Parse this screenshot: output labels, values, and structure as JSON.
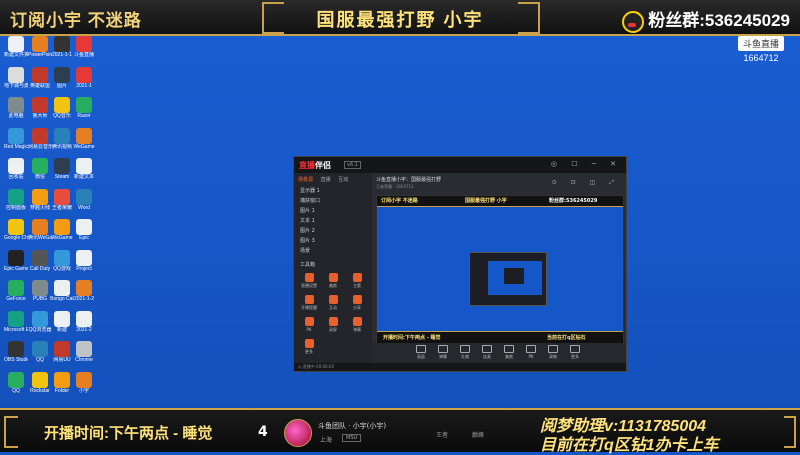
{
  "top_bar": {
    "left_text": "订阅小宇 不迷路",
    "center_text": "国服最强打野 小宇",
    "right_text": "粉丝群:536245029"
  },
  "watermark": {
    "logo": "斗鱼直播",
    "room_id": "1664712"
  },
  "desktop_icons": [
    {
      "label": "新建文件夹",
      "color": "#eef2f8"
    },
    {
      "label": "PowerPoint",
      "color": "#e67e22"
    },
    {
      "label": "2021-1-1",
      "color": "#333"
    },
    {
      "label": "斗鱼直播",
      "color": "#e53935"
    },
    {
      "label": "地下城与勇士",
      "color": "#ddd"
    },
    {
      "label": "英雄联盟",
      "color": "#c0392b"
    },
    {
      "label": "图片",
      "color": "#2c3e50"
    },
    {
      "label": "2021-1",
      "color": "#e53935"
    },
    {
      "label": "此电脑",
      "color": "#7f8c8d"
    },
    {
      "label": "鲁大师",
      "color": "#c0392b"
    },
    {
      "label": "QQ音乐",
      "color": "#f1c40f"
    },
    {
      "label": "Razer",
      "color": "#27ae60"
    },
    {
      "label": "Red Magic",
      "color": "#3498db"
    },
    {
      "label": "网易云音乐",
      "color": "#c0392b"
    },
    {
      "label": "腾讯视频",
      "color": "#2980b9"
    },
    {
      "label": "WeGame",
      "color": "#e67e22"
    },
    {
      "label": "回收站",
      "color": "#ecf0f1"
    },
    {
      "label": "微信",
      "color": "#27ae60"
    },
    {
      "label": "Steam",
      "color": "#2c3e50"
    },
    {
      "label": "新建文本",
      "color": "#ecf0f1"
    },
    {
      "label": "控制面板",
      "color": "#16a085"
    },
    {
      "label": "穿越火线",
      "color": "#f39c12"
    },
    {
      "label": "王者荣耀",
      "color": "#e74c3c"
    },
    {
      "label": "Word",
      "color": "#2980b9"
    },
    {
      "label": "Google Chrome",
      "color": "#f1c40f"
    },
    {
      "label": "腾讯WeGame",
      "color": "#e67e22"
    },
    {
      "label": "WeGame",
      "color": "#f39c12"
    },
    {
      "label": "Epic",
      "color": "#ecf0f1"
    },
    {
      "label": "Epic Games",
      "color": "#222"
    },
    {
      "label": "Call Duty",
      "color": "#555"
    },
    {
      "label": "QQ游戏",
      "color": "#3498db"
    },
    {
      "label": "Project",
      "color": "#ecf0f1"
    },
    {
      "label": "GeForce",
      "color": "#27ae60"
    },
    {
      "label": "PUBG",
      "color": "#7f8c8d"
    },
    {
      "label": "Bongo Cat",
      "color": "#ecf0f1"
    },
    {
      "label": "2021-1-2",
      "color": "#e67e22"
    },
    {
      "label": "Microsoft Edge",
      "color": "#16a085"
    },
    {
      "label": "QQ浏览器",
      "color": "#3498db"
    },
    {
      "label": "新建",
      "color": "#ecf0f1"
    },
    {
      "label": "2021-2",
      "color": "#ecf0f1"
    },
    {
      "label": "OBS Studio",
      "color": "#333"
    },
    {
      "label": "QQ",
      "color": "#2980b9"
    },
    {
      "label": "网易UU",
      "color": "#c0392b"
    },
    {
      "label": "Chrome",
      "color": "#bdc3c7"
    },
    {
      "label": "QQ",
      "color": "#27ae60"
    },
    {
      "label": "Rockstar",
      "color": "#f1c40f"
    },
    {
      "label": "Folder",
      "color": "#f39c12"
    },
    {
      "label": "小宇",
      "color": "#e67e22"
    }
  ],
  "stream_window": {
    "logo_prefix": "直播",
    "logo_suffix": "伴侣",
    "version": "v6.1",
    "controls": "◎ ☐ ─ ✕",
    "side_tabs": [
      "场景源",
      "直播",
      "互动"
    ],
    "scenes": [
      "显示器 1",
      "捕获窗口",
      "图片 1",
      "文本 1",
      "图片 2",
      "图片 3",
      "场景"
    ],
    "tools_label": "工具箱",
    "tools": [
      "直播设置",
      "美颜",
      "主题",
      "开播提醒",
      "互动",
      "分享",
      "PK",
      "录屏",
      "弹幕",
      "更多"
    ],
    "title": "斗鱼直播小宇：国服最强打野",
    "subtitle": "王者荣耀 · 1664712",
    "top_icons": "⊙ ⊡ ◫ ⤢",
    "preview_bar_left": "订阅小宇 不迷路",
    "preview_bar_center": "国服最强打野 小宇",
    "preview_bar_right": "粉丝群:536245029",
    "preview_bottom_left": "开播时间:下午两点 - 睡觉",
    "preview_bottom_right": "当前在打q区钻石",
    "footer_tools": [
      "画面",
      "弹幕",
      "礼物",
      "连麦",
      "美颜",
      "PK",
      "录制",
      "更多"
    ],
    "status": "◎ 直播中 00:00:00"
  },
  "bottom_bar": {
    "left_text": "开播时间:下午两点 - 睡觉",
    "rank_number": "4",
    "player_name": "斗鱼团队 · 小宇(小宇)",
    "player_region": "上海",
    "player_tag": "MSU",
    "rank_label_a": "王者",
    "rank_label_b": "巅峰",
    "right_line1": "阅梦助理v:1131785004",
    "right_line2": "目前在打q区钻1办卡上车"
  }
}
